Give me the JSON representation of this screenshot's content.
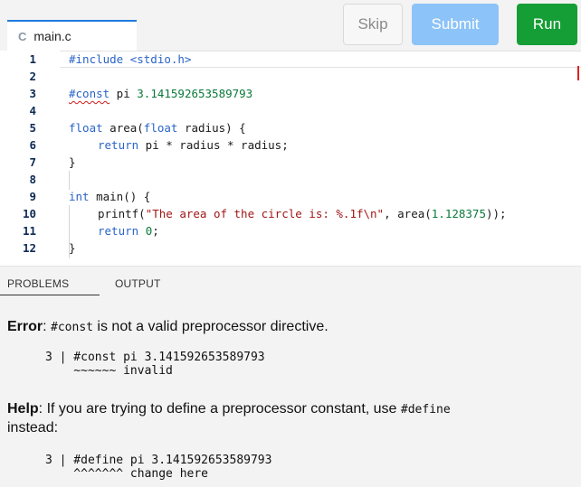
{
  "tab": {
    "icon": "c-language-icon",
    "icon_glyph": "C",
    "label": "main.c"
  },
  "toolbar": {
    "skip_label": "Skip",
    "submit_label": "Submit",
    "run_label": "Run"
  },
  "editor": {
    "line_numbers": [
      "1",
      "2",
      "3",
      "4",
      "5",
      "6",
      "7",
      "8",
      "9",
      "10",
      "11",
      "12"
    ],
    "lines": {
      "l1": "#include <stdio.h>",
      "l3_kw": "#const",
      "l3_rest": " pi ",
      "l3_num": "3.141592653589793",
      "l5_type": "float",
      "l5_mid": " area(",
      "l5_type2": "float",
      "l5_end": " radius) {",
      "l6_kw": "return",
      "l6_rest": " pi * radius * radius;",
      "l7": "}",
      "l9_type": "int",
      "l9_rest": " main() {",
      "l10_fn": "printf(",
      "l10_str": "\"The area of the circle is: %.1f\\n\"",
      "l10_mid": ", area(",
      "l10_num": "1.128375",
      "l10_end": "));",
      "l11_kw": "return",
      "l11_sp": " ",
      "l11_num": "0",
      "l11_end": ";",
      "l12": "}"
    }
  },
  "panel": {
    "tabs": {
      "problems": "PROBLEMS",
      "output": "OUTPUT"
    },
    "error": {
      "label": "Error",
      "colon": ": ",
      "code": "#const",
      "text": " is not a valid preprocessor directive.",
      "snippet_line": "3 | #const pi 3.141592653589793",
      "snippet_mark": "    ~~~~~~ invalid"
    },
    "help": {
      "label": "Help",
      "text1": ": If you are trying to define a preprocessor constant, use ",
      "code": "#define",
      "text2": "instead:",
      "snippet_line": "3 | #define pi 3.141592653589793",
      "snippet_mark": "    ^^^^^^^ change here"
    }
  },
  "colors": {
    "accent": "#1f7ae0",
    "submit": "#8cc3f8",
    "run": "#159e35",
    "keyword": "#2a64c8",
    "string": "#a31515",
    "number": "#0a7a3a",
    "error": "#d01c1c"
  }
}
